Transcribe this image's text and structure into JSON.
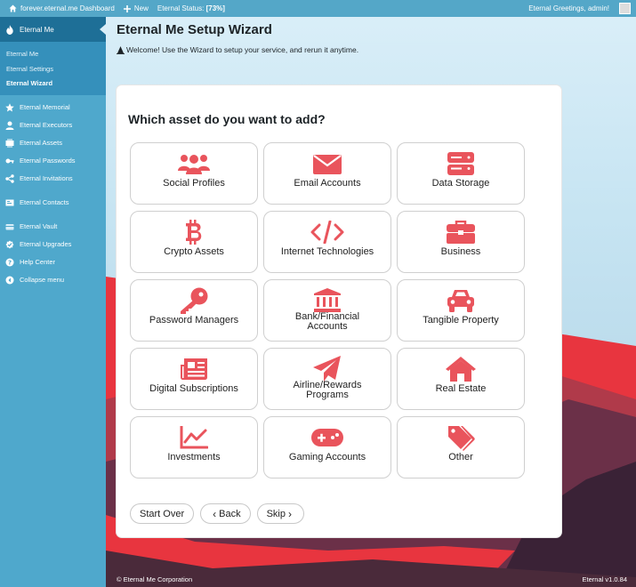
{
  "topbar": {
    "site_label": "forever.eternal.me Dashboard",
    "new_label": "New",
    "status_label": "Eternal Status:",
    "status_value": "[73%]",
    "greeting": "Eternal Greetings, admin!"
  },
  "sidebar": {
    "active_label": "Eternal Me",
    "submenu": [
      "Eternal Me",
      "Eternal Settings",
      "Eternal Wizard"
    ],
    "items": [
      {
        "label": "Eternal Memorial",
        "icon": "star-icon"
      },
      {
        "label": "Eternal Executors",
        "icon": "user-icon"
      },
      {
        "label": "Eternal Assets",
        "icon": "assets-icon"
      },
      {
        "label": "Eternal Passwords",
        "icon": "key-icon"
      },
      {
        "label": "Eternal Invitations",
        "icon": "share-icon"
      },
      {
        "label": "Eternal Contacts",
        "icon": "contacts-icon"
      },
      {
        "label": "Eternal Vault",
        "icon": "vault-icon"
      },
      {
        "label": "Eternal Upgrades",
        "icon": "upgrade-icon"
      },
      {
        "label": "Help Center",
        "icon": "help-icon"
      },
      {
        "label": "Collapse menu",
        "icon": "collapse-icon"
      }
    ]
  },
  "page": {
    "title": "Eternal Me Setup Wizard",
    "welcome": "Welcome! Use the Wizard to setup your service, and rerun it anytime.",
    "question": "Which asset do you want to add?",
    "accent_color": "#e9545c",
    "tiles": [
      [
        "Social Profiles"
      ],
      [
        "Email Accounts"
      ],
      [
        "Data Storage"
      ],
      [
        "Crypto Assets"
      ],
      [
        "Internet Technologies"
      ],
      [
        "Business"
      ],
      [
        "Password Managers"
      ],
      [
        "Bank/Financial",
        "Accounts"
      ],
      [
        "Tangible Property"
      ],
      [
        "Digital Subscriptions"
      ],
      [
        "Airline/Rewards",
        "Programs"
      ],
      [
        "Real Estate"
      ],
      [
        "Investments"
      ],
      [
        "Gaming Accounts"
      ],
      [
        "Other"
      ]
    ],
    "buttons": {
      "start_over": "Start Over",
      "back": "Back",
      "skip": "Skip"
    }
  },
  "footer": {
    "left": "© Eternal Me Corporation",
    "right": "Eternal v1.0.84"
  }
}
